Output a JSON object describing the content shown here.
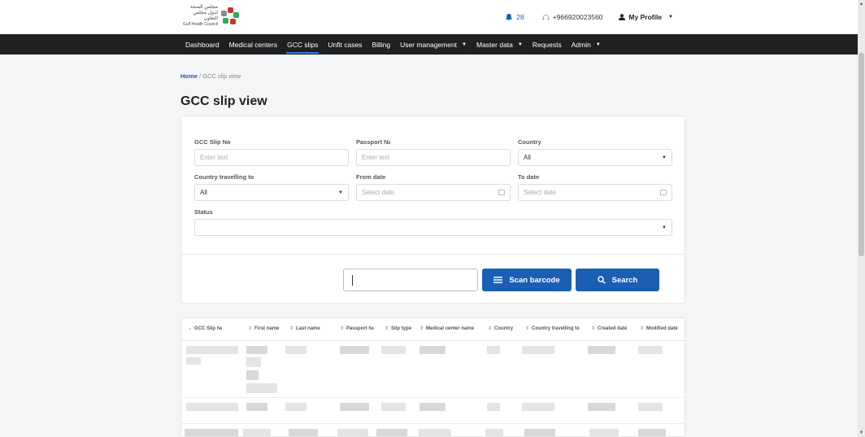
{
  "header": {
    "logo_ar_line1": "مجلس الصحة",
    "logo_ar_line2": "لدول مجلس التعاون",
    "logo_en": "Gulf Health Council",
    "notification_count": "28",
    "phone": "+966920023560",
    "profile_label": "My Profile"
  },
  "nav": {
    "items": [
      {
        "label": "Dashboard",
        "dropdown": false
      },
      {
        "label": "Medical centers",
        "dropdown": false
      },
      {
        "label": "GCC slips",
        "dropdown": false,
        "active": true
      },
      {
        "label": "Unfit cases",
        "dropdown": false
      },
      {
        "label": "Billing",
        "dropdown": false
      },
      {
        "label": "User management",
        "dropdown": true
      },
      {
        "label": "Master data",
        "dropdown": true
      },
      {
        "label": "Requests",
        "dropdown": false
      },
      {
        "label": "Admin",
        "dropdown": true
      }
    ]
  },
  "breadcrumb": {
    "home": "Home",
    "separator": "/",
    "current": "GCC slip view"
  },
  "page": {
    "title": "GCC slip view"
  },
  "filters": {
    "gcc_slip_no": {
      "label": "GCC Slip No",
      "placeholder": "Enter text"
    },
    "passport_no": {
      "label": "Passport №",
      "placeholder": "Enter text"
    },
    "country": {
      "label": "Country",
      "value": "All"
    },
    "country_travelling_to": {
      "label": "Country travelling to",
      "value": "All"
    },
    "from_date": {
      "label": "From date",
      "placeholder": "Select date"
    },
    "to_date": {
      "label": "To date",
      "placeholder": "Select date"
    },
    "status": {
      "label": "Status",
      "value": ""
    }
  },
  "actions": {
    "scan_label": "Scan barcode",
    "search_label": "Search"
  },
  "table": {
    "columns": [
      "GCC Slip №",
      "First name",
      "Last name",
      "Passport №",
      "Slip type",
      "Medical center name",
      "Country",
      "Country travelling to",
      "Created date",
      "Modified date"
    ]
  },
  "colors": {
    "primary": "#1a5fb4",
    "nav_bg": "#1f2022",
    "page_bg": "#f4f5f7"
  }
}
